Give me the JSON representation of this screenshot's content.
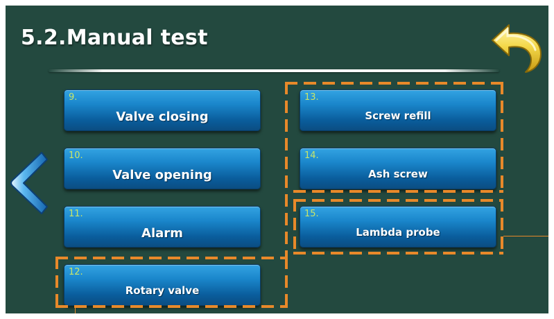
{
  "screen": {
    "title": "5.2.Manual test",
    "background_color": "#23493f",
    "accent_color": "#e8892a",
    "button_color": "#1a86cb",
    "number_color": "#c8e66a"
  },
  "navigation": {
    "back_icon": "curved-return-arrow-icon",
    "prev_icon": "chevron-left-icon"
  },
  "buttons": [
    {
      "number": "9.",
      "label": "Valve closing"
    },
    {
      "number": "10.",
      "label": "Valve opening"
    },
    {
      "number": "11.",
      "label": "Alarm"
    },
    {
      "number": "12.",
      "label": "Rotary valve"
    },
    {
      "number": "13.",
      "label": "Screw refill"
    },
    {
      "number": "14.",
      "label": "Ash screw"
    },
    {
      "number": "15.",
      "label": "Lambda probe"
    }
  ]
}
